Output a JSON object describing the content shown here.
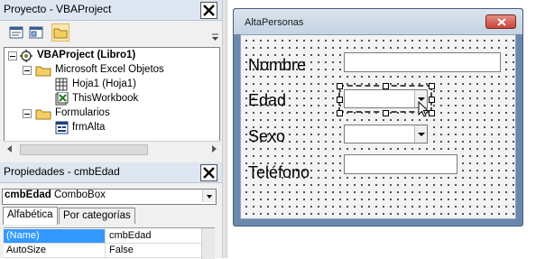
{
  "project": {
    "title": "Proyecto - VBAProject",
    "tree": {
      "root": "VBAProject (Libro1)",
      "folder_objects": "Microsoft Excel Objetos",
      "sheet1": "Hoja1 (Hoja1)",
      "workbook": "ThisWorkbook",
      "folder_forms": "Formularios",
      "form1": "frmAlta"
    }
  },
  "properties": {
    "title": "Propiedades - cmbEdad",
    "object_name": "cmbEdad",
    "object_type": "ComboBox",
    "tabs": [
      "Alfabética",
      "Por categorías"
    ],
    "rows": [
      {
        "name": "(Name)",
        "value": "cmbEdad"
      },
      {
        "name": "AutoSize",
        "value": "False"
      }
    ]
  },
  "userform": {
    "caption": "AltaPersonas",
    "labels": {
      "nombre": "Nombre",
      "edad": "Edad",
      "sexo": "Sexo",
      "telefono": "Teléfono"
    }
  },
  "colors": {
    "selection": "#3399ff",
    "form_border": "#6b87ad",
    "close_red": "#c7463a"
  },
  "icons": [
    "close-icon",
    "view-code-icon",
    "view-object-icon",
    "toggle-folders-icon",
    "vbaproject-icon",
    "folder-icon",
    "worksheet-icon",
    "workbook-icon",
    "userform-icon",
    "cursor-icon"
  ]
}
